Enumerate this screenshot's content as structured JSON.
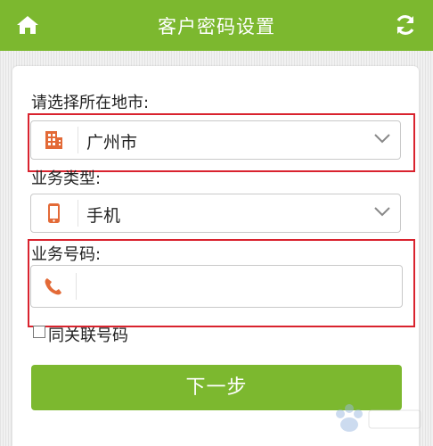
{
  "header": {
    "title": "客户密码设置",
    "home_icon": "home-icon",
    "refresh_icon": "refresh-icon",
    "background_color": "#7cb82f"
  },
  "form": {
    "city": {
      "label": "请选择所在地市:",
      "value": "广州市",
      "icon": "building-icon"
    },
    "business_type": {
      "label": "业务类型:",
      "value": "手机",
      "icon": "mobile-phone-icon"
    },
    "business_number": {
      "label": "业务号码:",
      "value": "",
      "icon": "phone-handset-icon"
    },
    "related_number_checkbox": {
      "label": "同关联号码",
      "checked": false
    },
    "next_button": {
      "label": "下一步"
    }
  },
  "colors": {
    "accent": "#7cb82f",
    "icon_orange": "#e36a37",
    "highlight_red": "#d9232e"
  }
}
